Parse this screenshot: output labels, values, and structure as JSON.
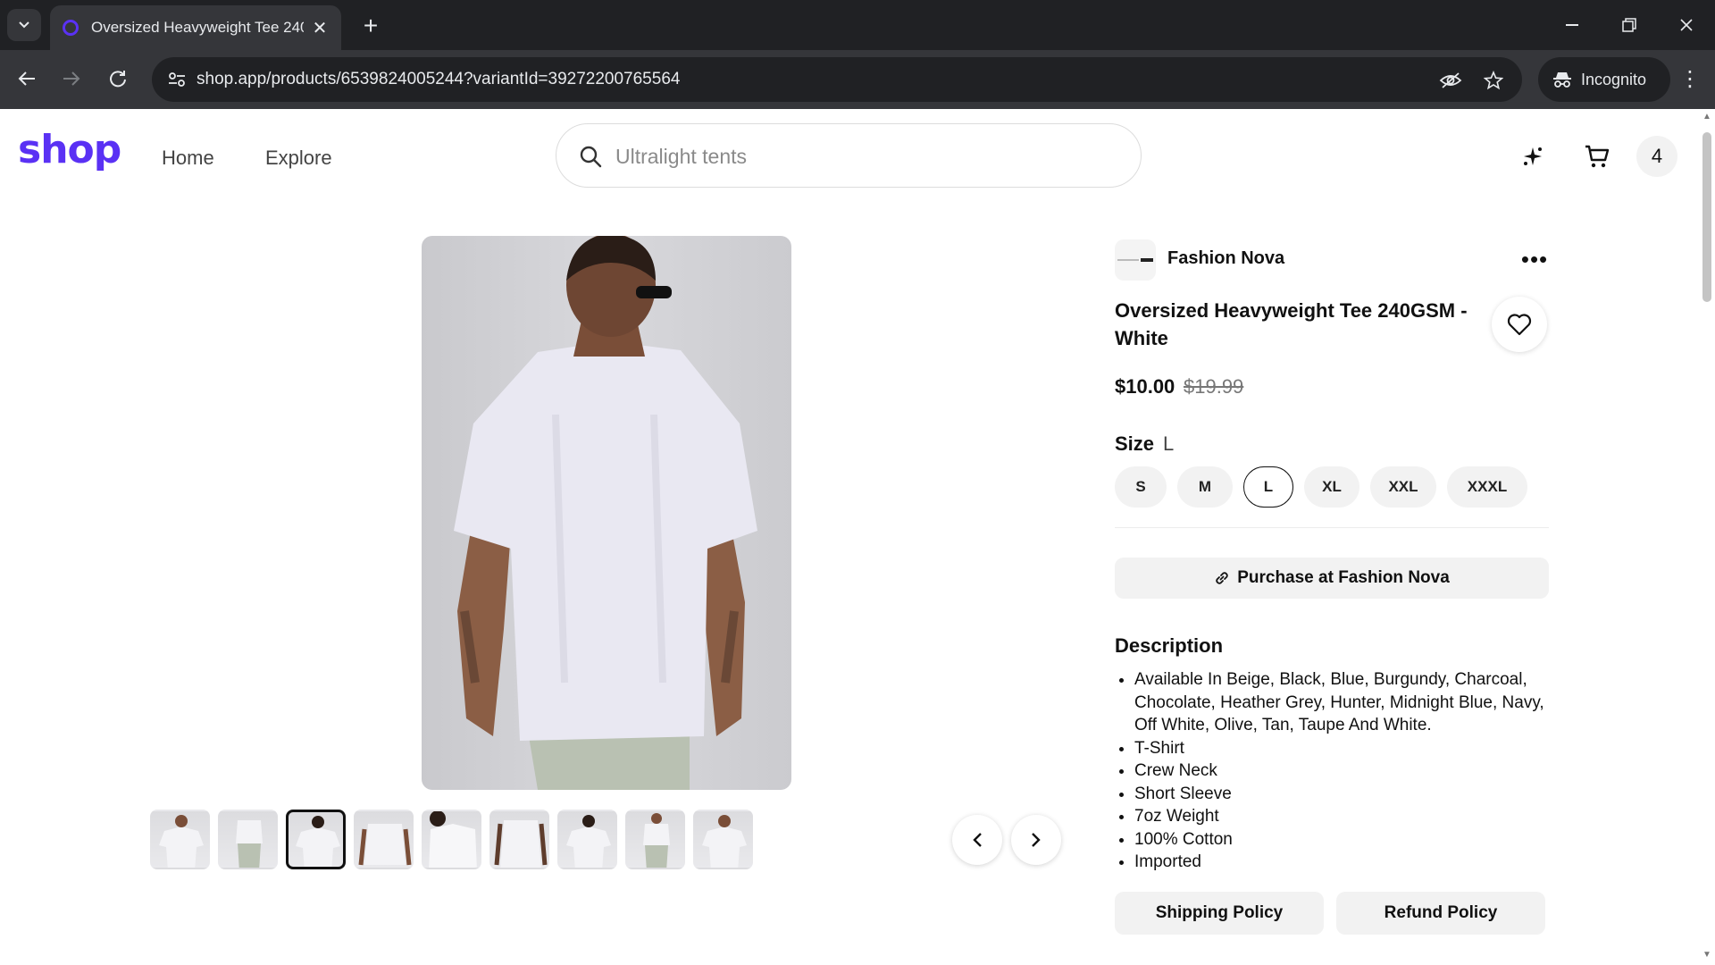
{
  "browser": {
    "tab_title": "Oversized Heavyweight Tee 240",
    "url": "shop.app/products/6539824005244?variantId=39272200765564",
    "incognito_label": "Incognito"
  },
  "header": {
    "logo": "shop",
    "nav": [
      "Home",
      "Explore"
    ],
    "search_placeholder": "Ultralight tents",
    "avatar_label": "4"
  },
  "product": {
    "merchant": "Fashion Nova",
    "title": "Oversized Heavyweight Tee 240GSM - White",
    "price": "$10.00",
    "compare_price": "$19.99",
    "size_label": "Size",
    "selected_size": "L",
    "sizes": [
      "S",
      "M",
      "L",
      "XL",
      "XXL",
      "XXXL"
    ],
    "purchase_label": "Purchase at Fashion Nova",
    "description_title": "Description",
    "description_items": [
      "Available In Beige, Black, Blue, Burgundy, Charcoal, Chocolate, Heather Grey, Hunter, Midnight Blue, Navy, Off White, Olive, Tan, Taupe And White.",
      "T-Shirt",
      "Crew Neck",
      "Short Sleeve",
      "7oz Weight",
      "100% Cotton",
      "Imported"
    ],
    "shipping_policy": "Shipping Policy",
    "refund_policy": "Refund Policy"
  },
  "gallery": {
    "thumbnail_count": 9,
    "active_thumbnail": 3
  },
  "colors": {
    "brand": "#5a31f4",
    "chrome_dark": "#202124",
    "chrome_mid": "#35363a"
  }
}
